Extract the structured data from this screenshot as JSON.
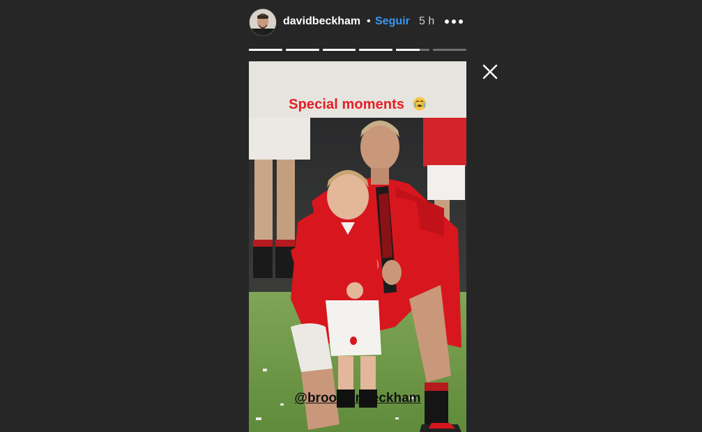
{
  "header": {
    "username": "davidbeckham",
    "separator": "•",
    "follow_label": "Seguir",
    "time_ago": "5 h",
    "more_icon": "ellipsis-icon",
    "close_icon": "close-icon"
  },
  "progress": {
    "segments": 6,
    "filled": [
      1,
      1,
      1,
      1,
      0.7,
      0
    ]
  },
  "story": {
    "caption": "Special moments",
    "caption_emoji": "crying-face-emoji",
    "mention": "@brooklynbeckham"
  },
  "colors": {
    "background": "#262626",
    "caption_red": "#e41e25",
    "follow_blue": "#3897f0",
    "jersey_red": "#d8161e",
    "grass_green": "#6f9a45"
  }
}
